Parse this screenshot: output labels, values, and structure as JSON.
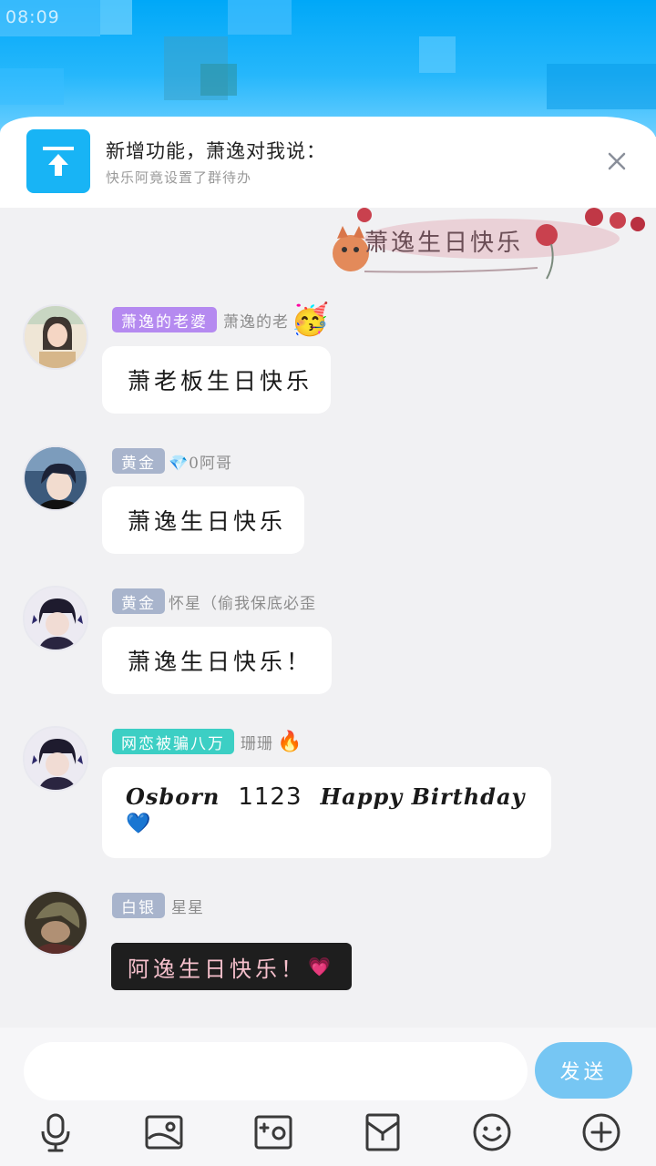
{
  "status_bar": {
    "time": "08:09"
  },
  "notice": {
    "title": "新增功能，萧逸对我说：",
    "subtitle": "快乐阿竟设置了群待办"
  },
  "banner": {
    "text": "萧逸生日快乐"
  },
  "messages": [
    {
      "badge": "萧逸的老婆",
      "badge_color": "#b58af0",
      "nickname": "萧逸的老",
      "emoji": "🥳",
      "text": "萧老板生日快乐"
    },
    {
      "badge": "黄金",
      "badge_color": "#a8b4cc",
      "nickname": "💎0阿哥",
      "text": "萧逸生日快乐"
    },
    {
      "badge": "黄金",
      "badge_color": "#a8b4cc",
      "nickname": "怀星（偷我保底必歪",
      "text": "萧逸生日快乐！"
    },
    {
      "badge": "网恋被骗八万",
      "badge_color": "#3ccfc4",
      "nickname": "珊珊",
      "emoji": "🔥",
      "text_script": "Osborn",
      "text_number": "1123",
      "text_script2": "Happy Birthday",
      "text_emoji": "💙"
    },
    {
      "badge": "白银",
      "badge_color": "#a8b4cc",
      "nickname": "星星",
      "text": "阿逸生日快乐！",
      "text_emoji": "💗"
    }
  ],
  "input": {
    "placeholder": "",
    "send_label": "发送"
  },
  "toolbar": [
    "microphone-icon",
    "image-icon",
    "camera-icon",
    "red-packet-icon",
    "emoji-icon",
    "plus-icon"
  ],
  "colors": {
    "header_blue": "#00a8f8",
    "send_blue": "#76c6f3",
    "badge_purple": "#b58af0",
    "badge_teal": "#3ccfc4"
  }
}
